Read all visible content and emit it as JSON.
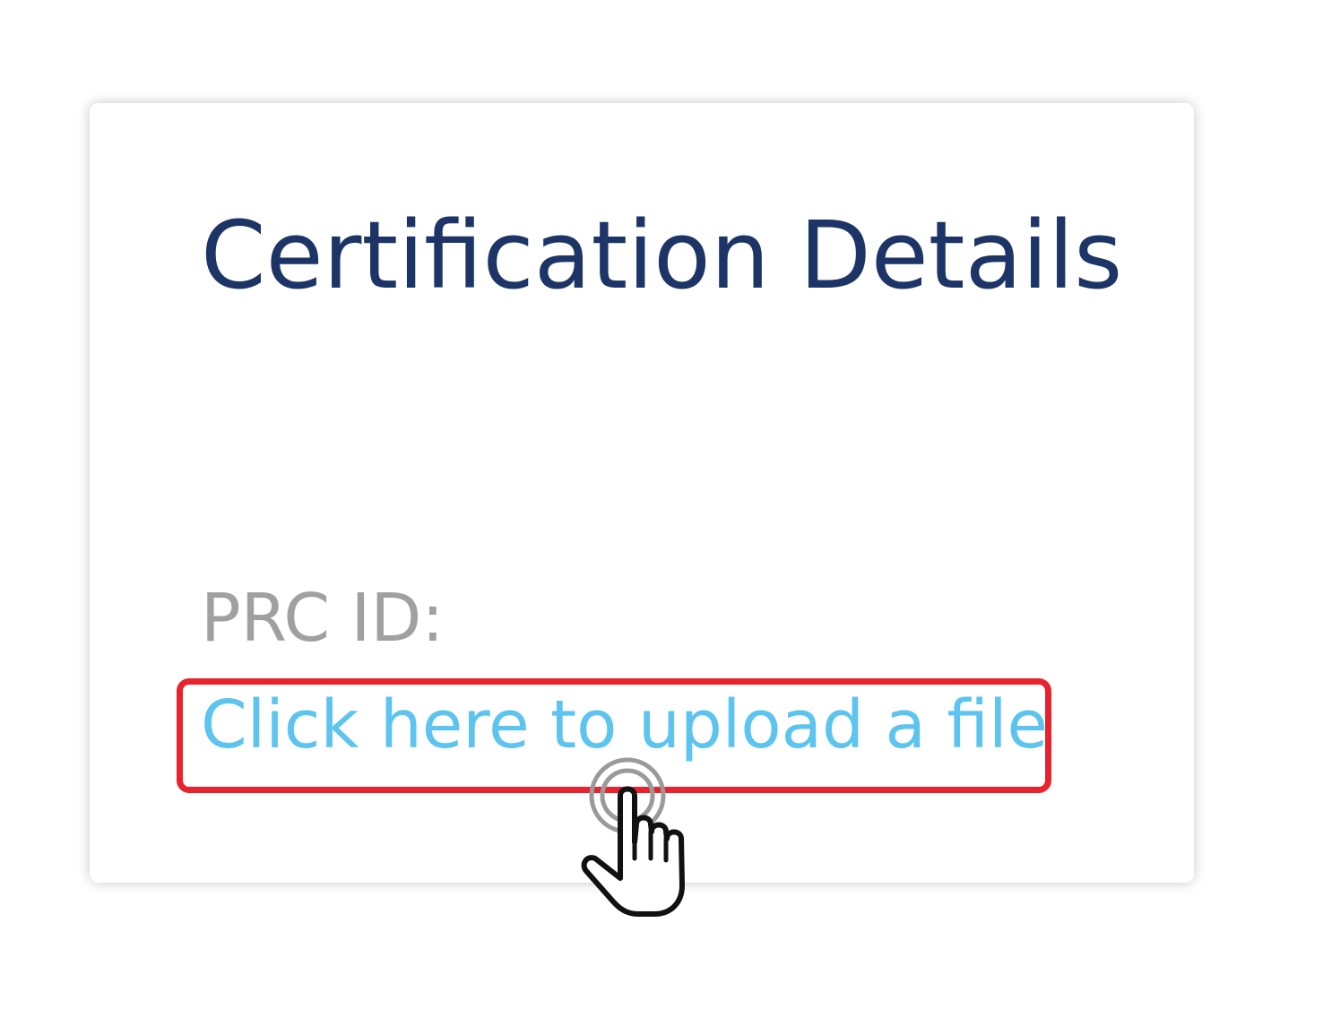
{
  "card": {
    "title": "Certification Details",
    "prc_label": "PRC ID:",
    "upload_link": "Click here to upload a file"
  },
  "colors": {
    "title": "#1d3566",
    "label": "#a0a0a0",
    "link": "#5cc4ee",
    "highlight": "#e8232d"
  },
  "icons": {
    "cursor": "pointing-hand-tap-icon"
  }
}
